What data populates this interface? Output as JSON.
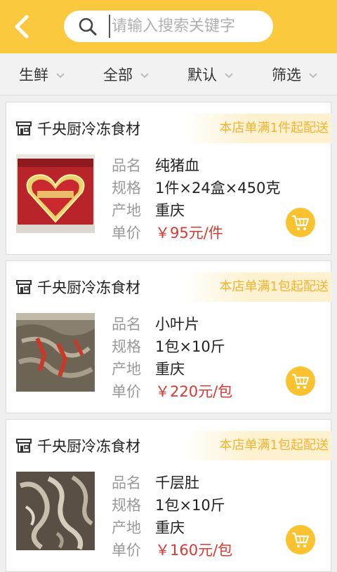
{
  "search": {
    "placeholder": "请输入搜索关键字",
    "value": ""
  },
  "filters": [
    {
      "label": "生鲜"
    },
    {
      "label": "全部"
    },
    {
      "label": "默认"
    },
    {
      "label": "筛选"
    }
  ],
  "field_labels": {
    "name": "品名",
    "spec": "规格",
    "origin": "产地",
    "price": "单价"
  },
  "products": [
    {
      "store": "千央厨冷冻食材",
      "promo": "本店单满1件起配送",
      "name": "纯猪血",
      "spec": "1件×24盒×450克",
      "origin": "重庆",
      "price": "￥95元/件"
    },
    {
      "store": "千央厨冷冻食材",
      "promo": "本店单满1包起配送",
      "name": "小叶片",
      "spec": "1包×10斤",
      "origin": "重庆",
      "price": "￥220元/包"
    },
    {
      "store": "千央厨冷冻食材",
      "promo": "本店单满1包起配送",
      "name": "千层肚",
      "spec": "1包×10斤",
      "origin": "重庆",
      "price": "￥160元/包"
    }
  ],
  "colors": {
    "brand": "#fbc93d",
    "price": "#d83a34",
    "promo": "#f1b432"
  },
  "icons": {
    "back": "chevron-left-icon",
    "search": "search-icon",
    "store": "store-icon",
    "cart": "cart-icon"
  }
}
